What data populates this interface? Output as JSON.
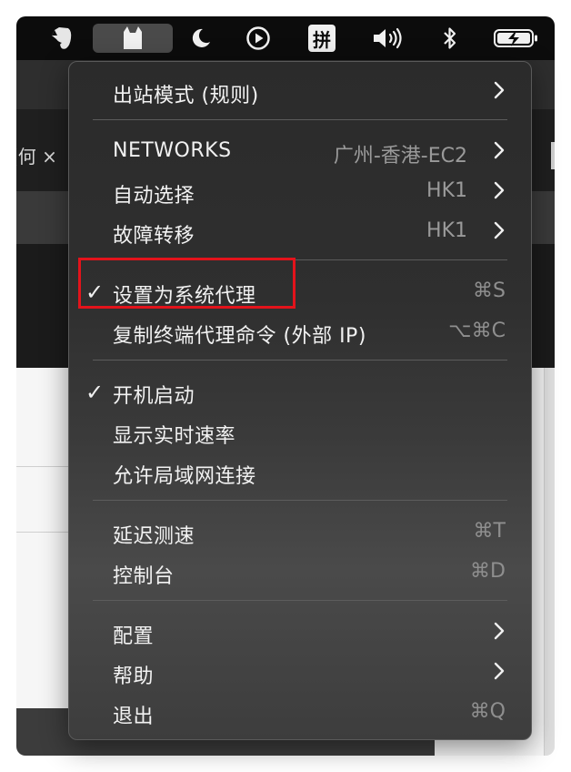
{
  "menubar": {
    "icons": [
      "evernote-icon",
      "cat-proxy-icon",
      "moon-icon",
      "play-circle-icon",
      "pinyin-input-icon",
      "volume-icon",
      "bluetooth-icon",
      "battery-charging-icon"
    ],
    "input_method_label": "拼"
  },
  "background": {
    "tab_text": "(何 ×"
  },
  "menu": {
    "outbound_mode": {
      "label": "出站模式 (规则)"
    },
    "networks": {
      "label": "NETWORKS",
      "value": "广州-香港-EC2"
    },
    "auto_select": {
      "label": "自动选择",
      "value": "HK1"
    },
    "failover": {
      "label": "故障转移",
      "value": "HK1"
    },
    "set_system_proxy": {
      "label": "设置为系统代理",
      "checked": true,
      "checkmark": "✓",
      "shortcut": "⌘S"
    },
    "copy_terminal_cmd": {
      "label": "复制终端代理命令 (外部 IP)",
      "shortcut": "⌥⌘C"
    },
    "launch_at_login": {
      "label": "开机启动",
      "checked": true,
      "checkmark": "✓"
    },
    "show_speed": {
      "label": "显示实时速率"
    },
    "allow_lan": {
      "label": "允许局域网连接"
    },
    "latency_test": {
      "label": "延迟测速",
      "shortcut": "⌘T"
    },
    "dashboard": {
      "label": "控制台",
      "shortcut": "⌘D"
    },
    "config": {
      "label": "配置"
    },
    "help": {
      "label": "帮助"
    },
    "quit": {
      "label": "退出",
      "shortcut": "⌘Q"
    }
  },
  "colors": {
    "highlight_border": "#e3131b",
    "menu_text": "#f2f2f2",
    "menu_muted": "#9a9a9a"
  }
}
